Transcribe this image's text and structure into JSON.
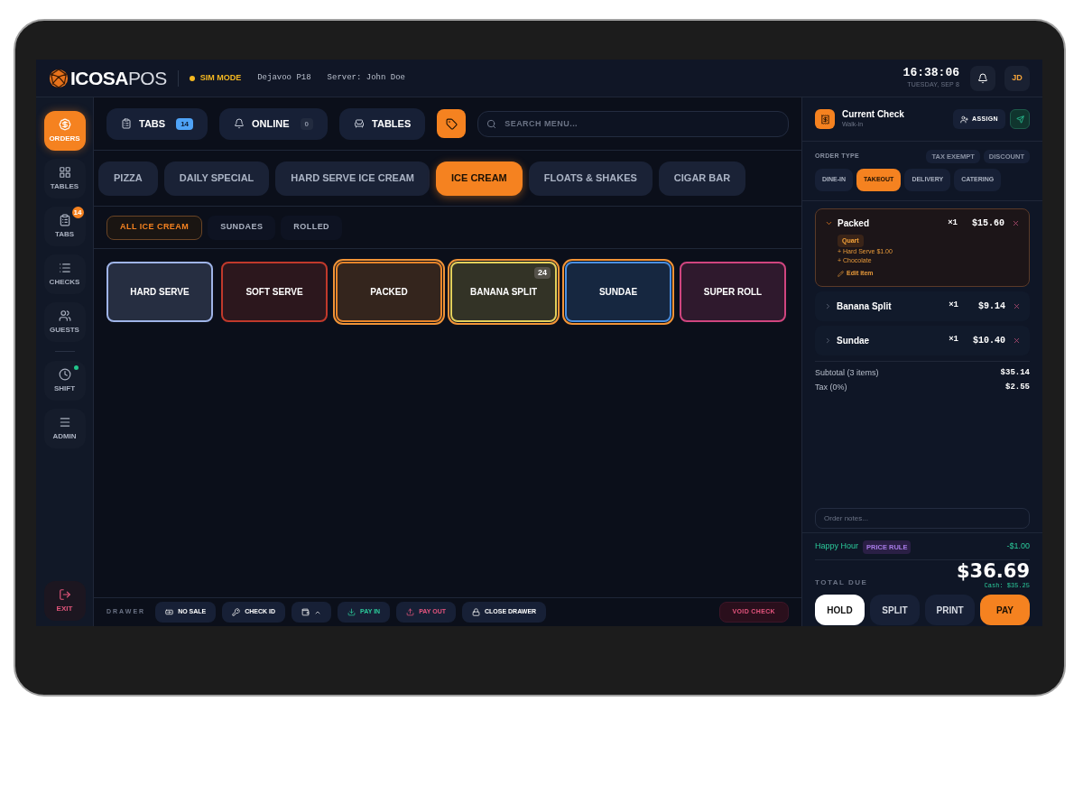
{
  "header": {
    "logo_bold": "ICOSA",
    "logo_light": "POS",
    "mode": "SIM MODE",
    "device": "Dejavoo P18",
    "server": "Server: John Doe",
    "time": "16:38:06",
    "date": "TUESDAY, SEP 8",
    "avatar": "JD"
  },
  "sidebar": {
    "items": [
      {
        "label": "ORDERS",
        "selected": true
      },
      {
        "label": "TABLES",
        "selected": false
      },
      {
        "label": "TABS",
        "selected": false,
        "badge": "14"
      },
      {
        "label": "CHECKS",
        "selected": false
      },
      {
        "label": "GUESTS",
        "selected": false
      }
    ],
    "tools": [
      {
        "label": "SHIFT",
        "status_dot": true
      },
      {
        "label": "ADMIN",
        "status_dot": false
      }
    ],
    "exit": "EXIT"
  },
  "toolbar": {
    "buttons": [
      {
        "label": "TABS",
        "count": "14",
        "kind": "highlight"
      },
      {
        "label": "ONLINE",
        "count": "0",
        "kind": "muted"
      },
      {
        "label": "TABLES",
        "kind": "plain"
      }
    ],
    "search_placeholder": "SEARCH MENU..."
  },
  "categories": [
    {
      "label": "PIZZA",
      "selected": false
    },
    {
      "label": "DAILY SPECIAL",
      "selected": false
    },
    {
      "label": "HARD SERVE ICE CREAM",
      "selected": false
    },
    {
      "label": "ICE CREAM",
      "selected": true
    },
    {
      "label": "FLOATS & SHAKES",
      "selected": false
    },
    {
      "label": "CIGAR BAR",
      "selected": false
    }
  ],
  "subcategories": [
    {
      "label": "ALL ICE CREAM",
      "selected": true
    },
    {
      "label": "SUNDAES",
      "selected": false
    },
    {
      "label": "ROLLED",
      "selected": false
    }
  ],
  "products": [
    {
      "name": "HARD SERVE",
      "color": "#9fb4e8",
      "selected": false
    },
    {
      "name": "SOFT SERVE",
      "color": "#c0392b",
      "selected": false
    },
    {
      "name": "PACKED",
      "color": "#e8852a",
      "selected": true
    },
    {
      "name": "BANANA SPLIT",
      "color": "#e3cf5a",
      "selected": true,
      "badge": "24"
    },
    {
      "name": "SUNDAE",
      "color": "#4a90e2",
      "selected": true
    },
    {
      "name": "SUPER ROLL",
      "color": "#d0457f",
      "selected": false
    }
  ],
  "drawer": {
    "label": "DRAWER",
    "buttons": [
      {
        "label": "NO SALE",
        "kind": "plain"
      },
      {
        "label": "CHECK ID",
        "kind": "plain"
      },
      {
        "kind": "menu"
      },
      {
        "label": "PAY IN",
        "kind": "in"
      },
      {
        "label": "PAY OUT",
        "kind": "out"
      },
      {
        "label": "CLOSE DRAWER",
        "kind": "plain"
      }
    ],
    "void": "VOID CHECK"
  },
  "check": {
    "title": "Current Check",
    "subtitle": "Walk-in",
    "assign": "ASSIGN",
    "order_type_label": "ORDER TYPE",
    "tags": [
      "TAX EXEMPT",
      "DISCOUNT"
    ],
    "order_types": [
      {
        "label": "DINE-IN",
        "selected": false
      },
      {
        "label": "TAKEOUT",
        "selected": true
      },
      {
        "label": "DELIVERY",
        "selected": false
      },
      {
        "label": "CATERING",
        "selected": false
      }
    ],
    "items": [
      {
        "name": "Packed",
        "qty": "×1",
        "price": "$15.60",
        "expanded": true,
        "option": "Quart",
        "modifiers": [
          "+ Hard Serve $1.00",
          "+ Chocolate"
        ],
        "edit": "Edit item"
      },
      {
        "name": "Banana Split",
        "qty": "×1",
        "price": "$9.14",
        "expanded": false
      },
      {
        "name": "Sundae",
        "qty": "×1",
        "price": "$10.40",
        "expanded": false
      }
    ],
    "totals": [
      {
        "label": "Subtotal (3 items)",
        "value": "$35.14"
      },
      {
        "label": "Tax (0%)",
        "value": "$2.55"
      }
    ],
    "notes_placeholder": "Order notes...",
    "rule": {
      "name": "Happy Hour",
      "badge": "PRICE RULE",
      "amount": "-$1.00"
    },
    "total_label": "TOTAL DUE",
    "total": "$36.69",
    "cash": "Cash: $35.25",
    "actions": [
      {
        "label": "HOLD",
        "kind": "light"
      },
      {
        "label": "SPLIT",
        "kind": "dark"
      },
      {
        "label": "PRINT",
        "kind": "dark"
      },
      {
        "label": "PAY",
        "kind": "primary"
      }
    ]
  }
}
